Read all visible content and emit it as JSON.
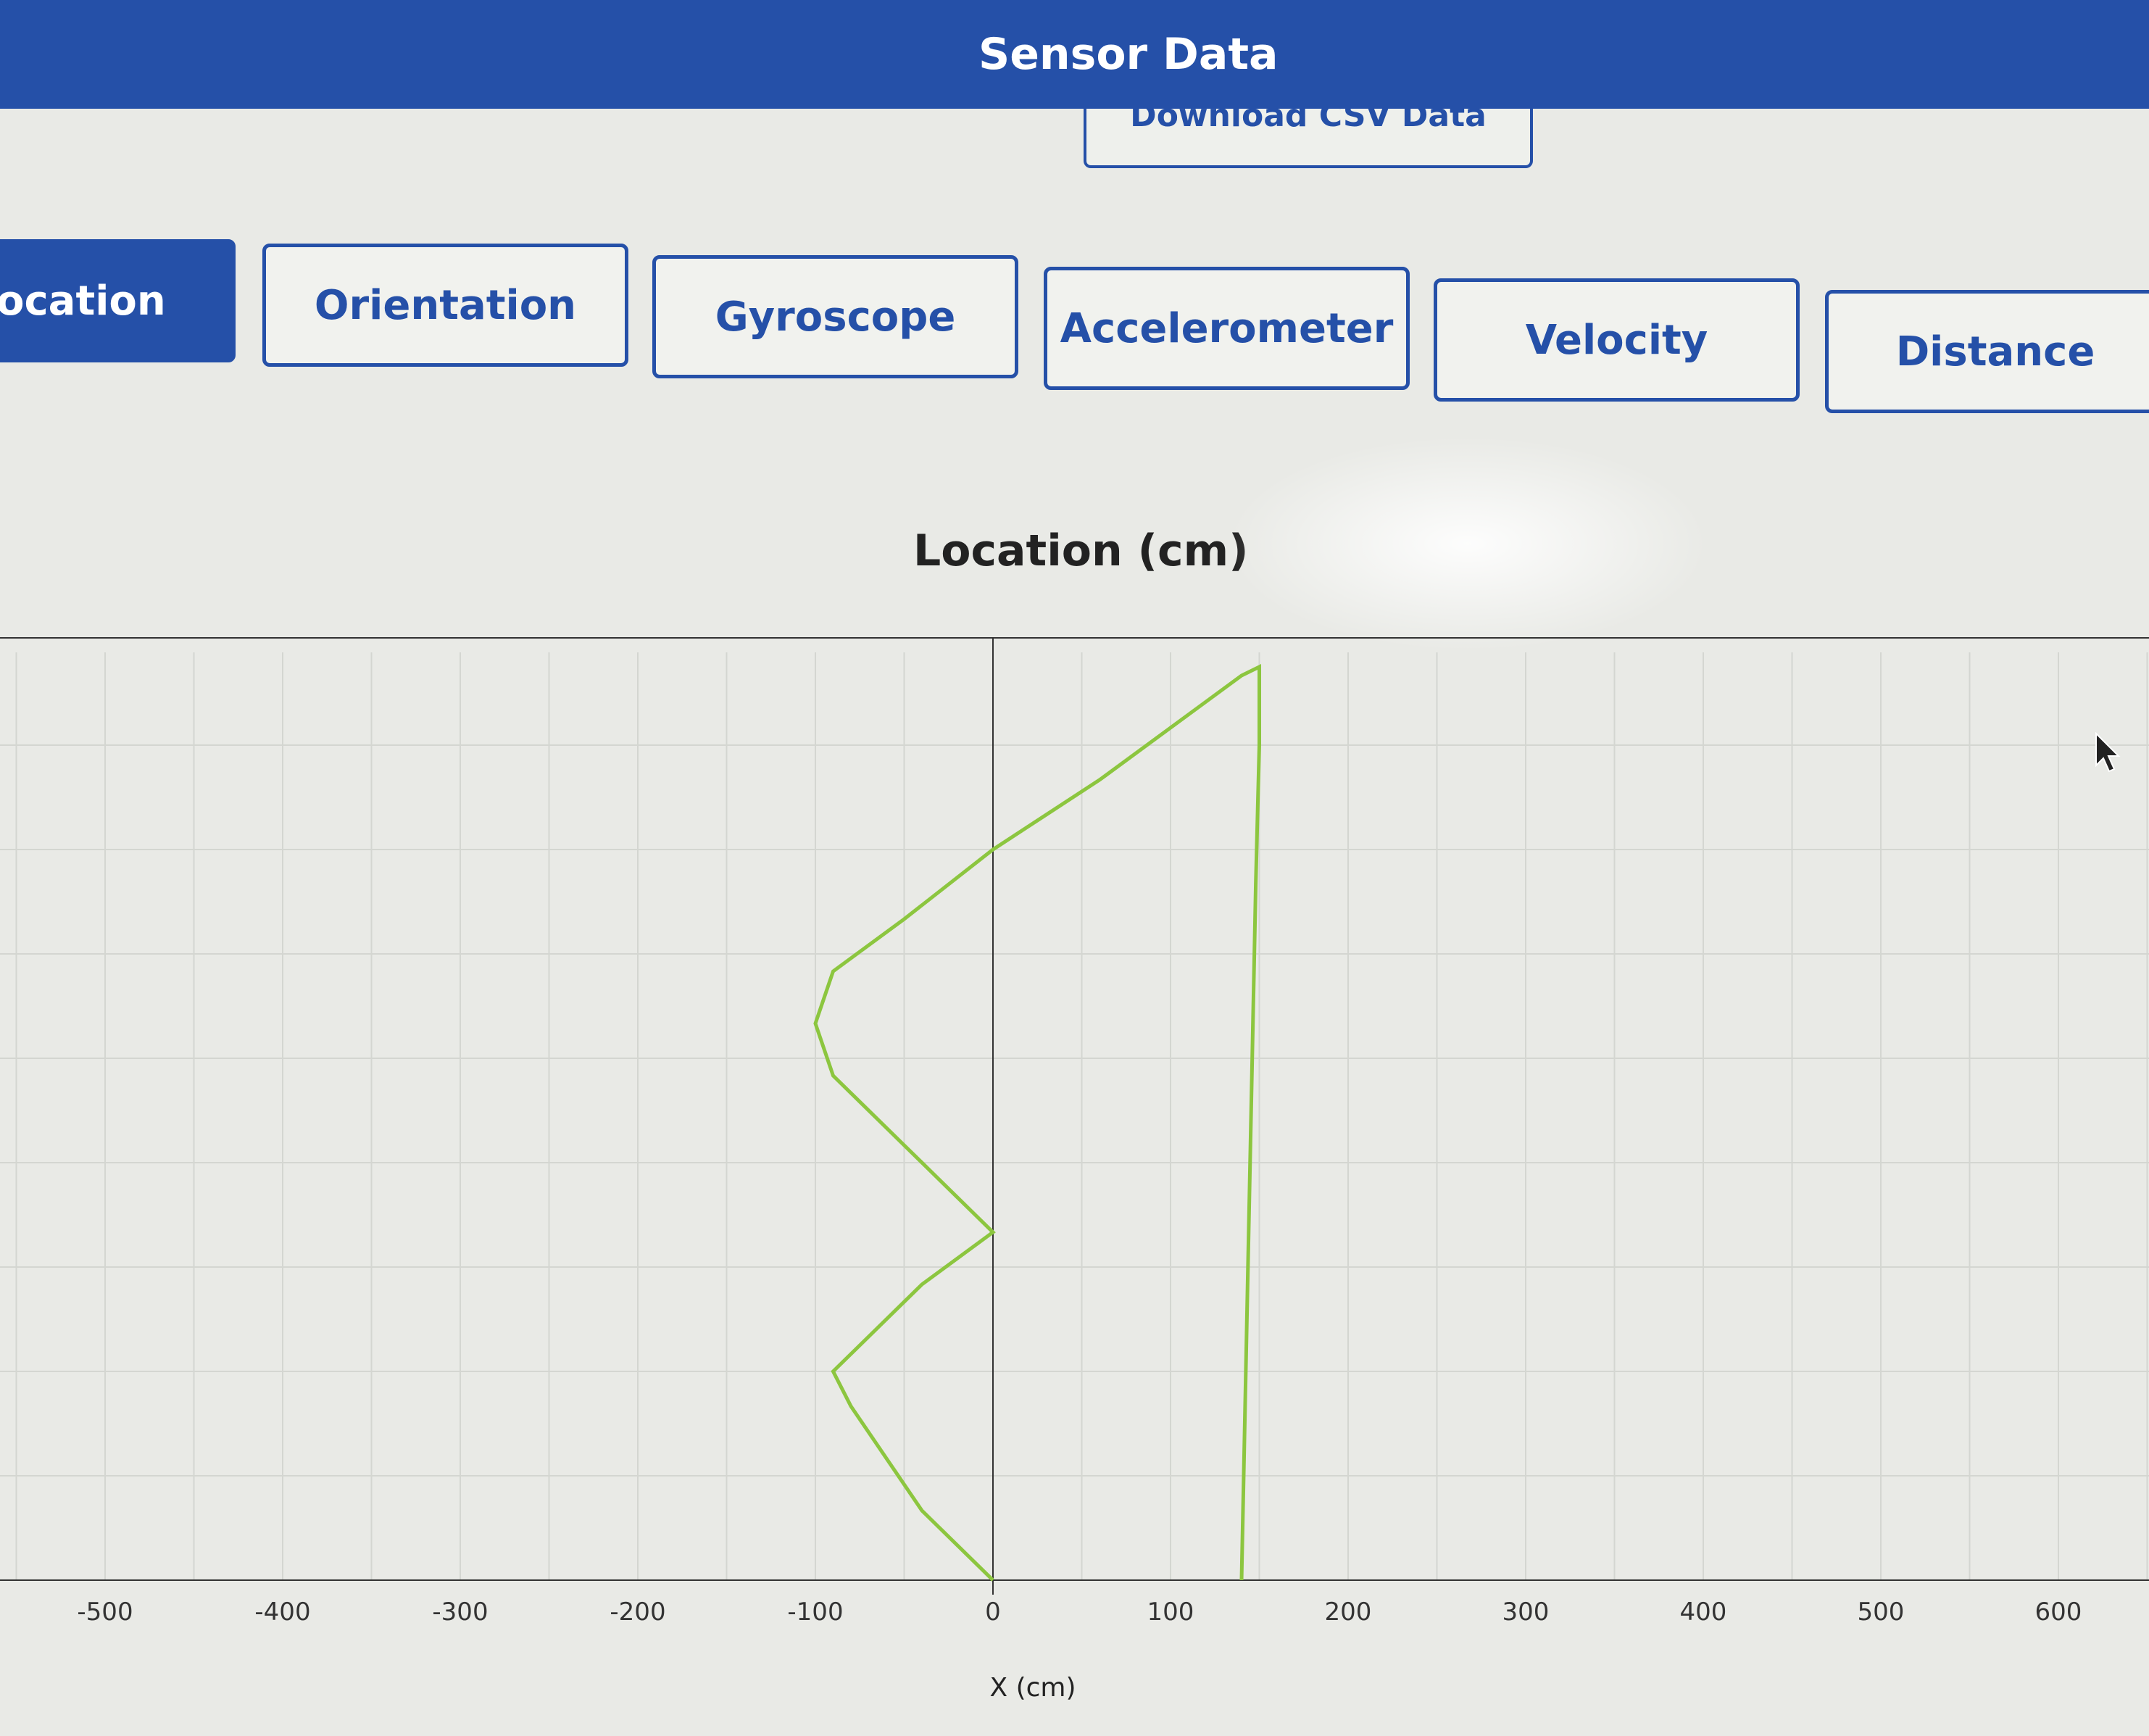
{
  "header": {
    "title": "Sensor Data",
    "download_label": "Download CSV Data"
  },
  "tabs": [
    {
      "label": "ocation",
      "active": true
    },
    {
      "label": "Orientation",
      "active": false
    },
    {
      "label": "Gyroscope",
      "active": false
    },
    {
      "label": "Accelerometer",
      "active": false
    },
    {
      "label": "Velocity",
      "active": false
    },
    {
      "label": "Distance",
      "active": false
    }
  ],
  "colors": {
    "brand": "#2550a8",
    "series": "#8cc63f",
    "background": "#e9eae6"
  },
  "chart_data": {
    "type": "line",
    "title": "Location (cm)",
    "xlabel": "X (cm)",
    "ylabel": "",
    "xlim": [
      -500,
      600
    ],
    "ylim": [
      0,
      500
    ],
    "x_ticks": [
      -500,
      -400,
      -300,
      -200,
      -100,
      0,
      100,
      200,
      300,
      400,
      500,
      600
    ],
    "grid": true,
    "series": [
      {
        "color": "#8cc63f",
        "points": [
          [
            0,
            0
          ],
          [
            -40,
            40
          ],
          [
            -80,
            100
          ],
          [
            -90,
            120
          ],
          [
            -80,
            130
          ],
          [
            -40,
            170
          ],
          [
            0,
            200
          ],
          [
            -10,
            210
          ],
          [
            -50,
            250
          ],
          [
            -90,
            290
          ],
          [
            -100,
            320
          ],
          [
            -90,
            350
          ],
          [
            -50,
            380
          ],
          [
            0,
            420
          ],
          [
            30,
            440
          ],
          [
            60,
            460
          ],
          [
            100,
            490
          ],
          [
            140,
            520
          ],
          [
            150,
            525
          ],
          [
            150,
            480
          ],
          [
            148,
            400
          ],
          [
            146,
            300
          ],
          [
            144,
            200
          ],
          [
            142,
            100
          ],
          [
            140,
            0
          ]
        ]
      }
    ]
  }
}
